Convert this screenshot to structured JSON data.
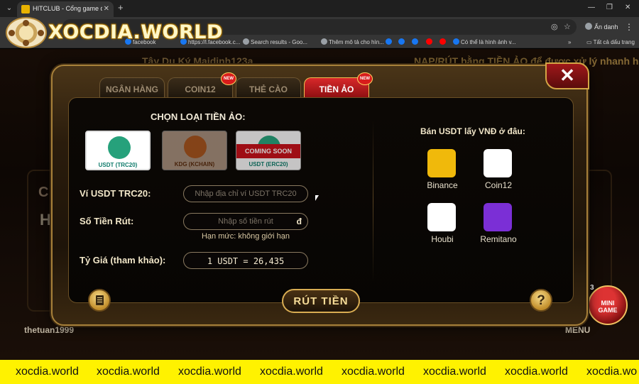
{
  "browser": {
    "tab_title": "HITCLUB - Cổng game đánh bài...",
    "omnibox_icons": [
      "eye-off-icon",
      "star-icon"
    ],
    "profile_label": "Ẩn danh",
    "bookmarks": [
      {
        "label": "facebook",
        "color": "#1877f2"
      },
      {
        "label": "https://l.facebook.c...",
        "color": "#1877f2"
      },
      {
        "label": "Search results - Goo...",
        "color": "#9aa0a6"
      },
      {
        "label": "Thêm mô tả cho hìn...",
        "color": "#9aa0a6"
      },
      {
        "label": "",
        "color": "#1877f2"
      },
      {
        "label": "",
        "color": "#1877f2"
      },
      {
        "label": "",
        "color": "#1877f2"
      },
      {
        "label": "",
        "color": "#ff0000"
      },
      {
        "label": "",
        "color": "#ff0000"
      },
      {
        "label": "Có thể là hình ảnh v...",
        "color": "#1877f2"
      }
    ],
    "all_bookmarks": "Tất cả dấu trang"
  },
  "watermark": {
    "logo_text": "XOCDIA.WORLD"
  },
  "game": {
    "marquee_left": "Tây Du Ký  Maidinh123a",
    "marquee_right": "NẠP/RÚT bằng TIỀN ẢO để được xử lý nhanh hơn",
    "player_name": "thetuan1999",
    "menu_label": "MENU",
    "mini_game_label": "MINI\nGAME",
    "mini_count": "3"
  },
  "modal": {
    "tabs": [
      {
        "label": "NGÂN HÀNG",
        "active": false,
        "new": false
      },
      {
        "label": "COIN12",
        "active": false,
        "new": true
      },
      {
        "label": "THẺ CÀO",
        "active": false,
        "new": false
      },
      {
        "label": "TIỀN ẢO",
        "active": true,
        "new": true
      }
    ],
    "new_badge": "NEW",
    "close_label": "✕",
    "choose_title": "CHỌN LOẠI TIỀN ẢO:",
    "coins": [
      {
        "label": "USDT (TRC20)",
        "state": "active"
      },
      {
        "label": "KDG (KCHAIN)",
        "state": "dim"
      },
      {
        "label": "USDT (ERC20)",
        "state": "soon",
        "badge": "COMING SOON"
      }
    ],
    "wallet_label": "Ví USDT TRC20:",
    "wallet_placeholder": "Nhập địa chỉ ví USDT TRC20",
    "amount_label": "Số Tiền Rút:",
    "amount_placeholder": "Nhập số tiền rút",
    "currency": "đ",
    "limit_text": "Hạn mức: không giới hạn",
    "rate_label": "Tỷ Giá (tham khảo):",
    "rate_value": "1 USDT = 26,435",
    "withdraw_label": "RÚT TIỀN",
    "help_label": "?",
    "right_title": "Bán USDT lấy VNĐ ở đâu:",
    "exchanges": [
      {
        "label": "Binance",
        "color": "#f0b90b"
      },
      {
        "label": "Coin12",
        "color": "#ffffff"
      },
      {
        "label": "Houbi",
        "color": "#ffffff"
      },
      {
        "label": "Remitano",
        "color": "#7b2fd6"
      }
    ]
  },
  "banner": {
    "items": [
      "xocdia.world",
      "xocdia.world",
      "xocdia.world",
      "xocdia.world",
      "xocdia.world",
      "xocdia.world",
      "xocdia.world",
      "xocdia.wo"
    ]
  }
}
